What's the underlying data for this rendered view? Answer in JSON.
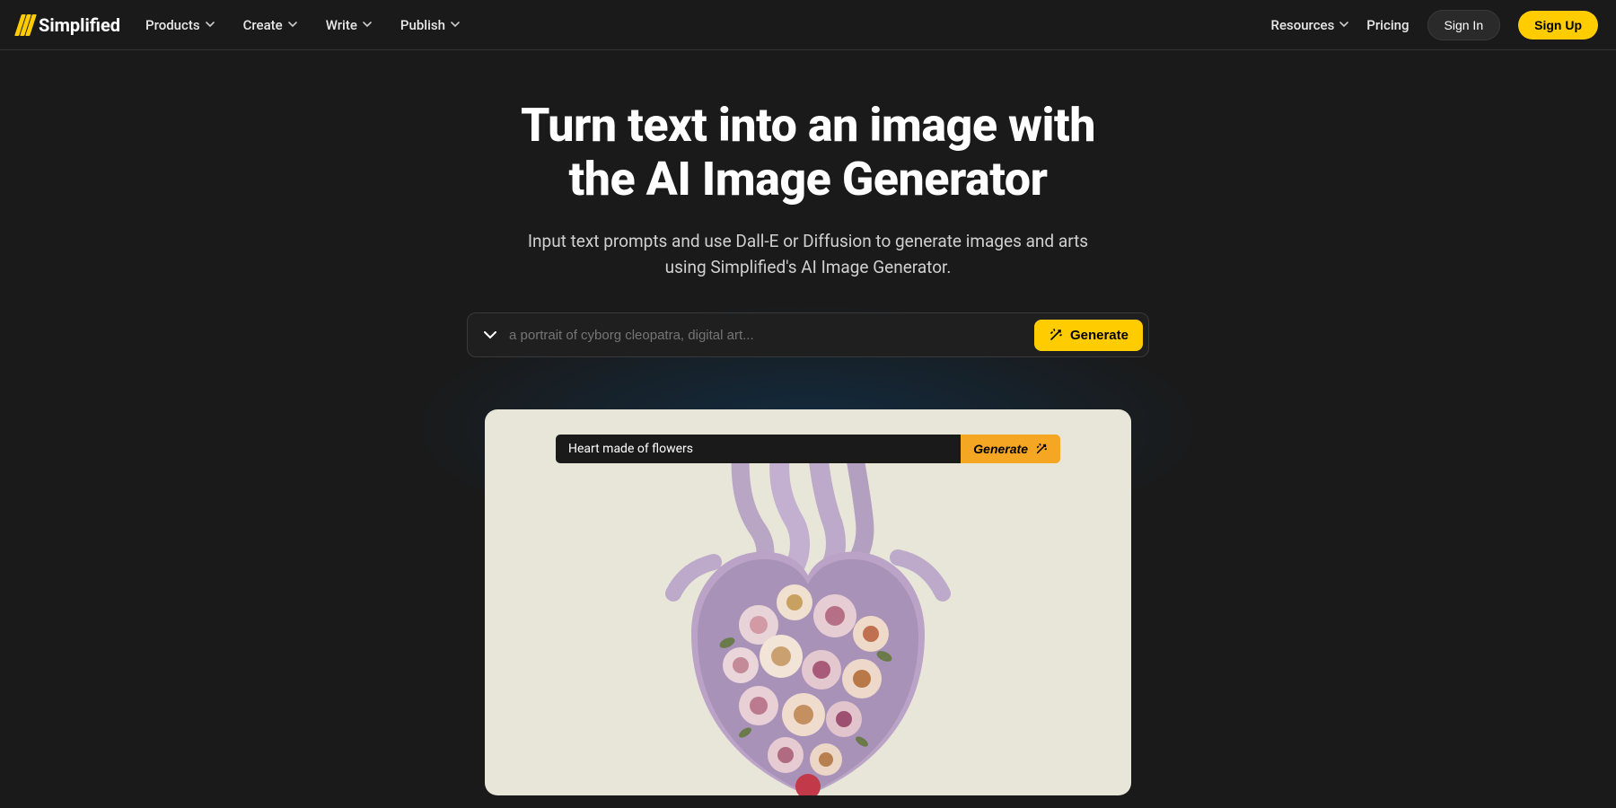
{
  "brand": {
    "name": "Simplified"
  },
  "nav": {
    "left": [
      {
        "label": "Products"
      },
      {
        "label": "Create"
      },
      {
        "label": "Write"
      },
      {
        "label": "Publish"
      }
    ],
    "right": {
      "resources": "Resources",
      "pricing": "Pricing",
      "signin": "Sign In",
      "signup": "Sign Up"
    }
  },
  "hero": {
    "headline_l1": "Turn text into an image with",
    "headline_l2": "the AI Image Generator",
    "sub_l1": "Input text prompts and use Dall-E or Diffusion to generate images and arts",
    "sub_l2": "using Simplified's AI Image Generator."
  },
  "prompt": {
    "placeholder": "a portrait of cyborg cleopatra, digital art...",
    "generate": "Generate"
  },
  "preview": {
    "prompt_text": "Heart made of flowers",
    "generate": "Generate",
    "image_description": "Anatomical heart made of flowers"
  }
}
